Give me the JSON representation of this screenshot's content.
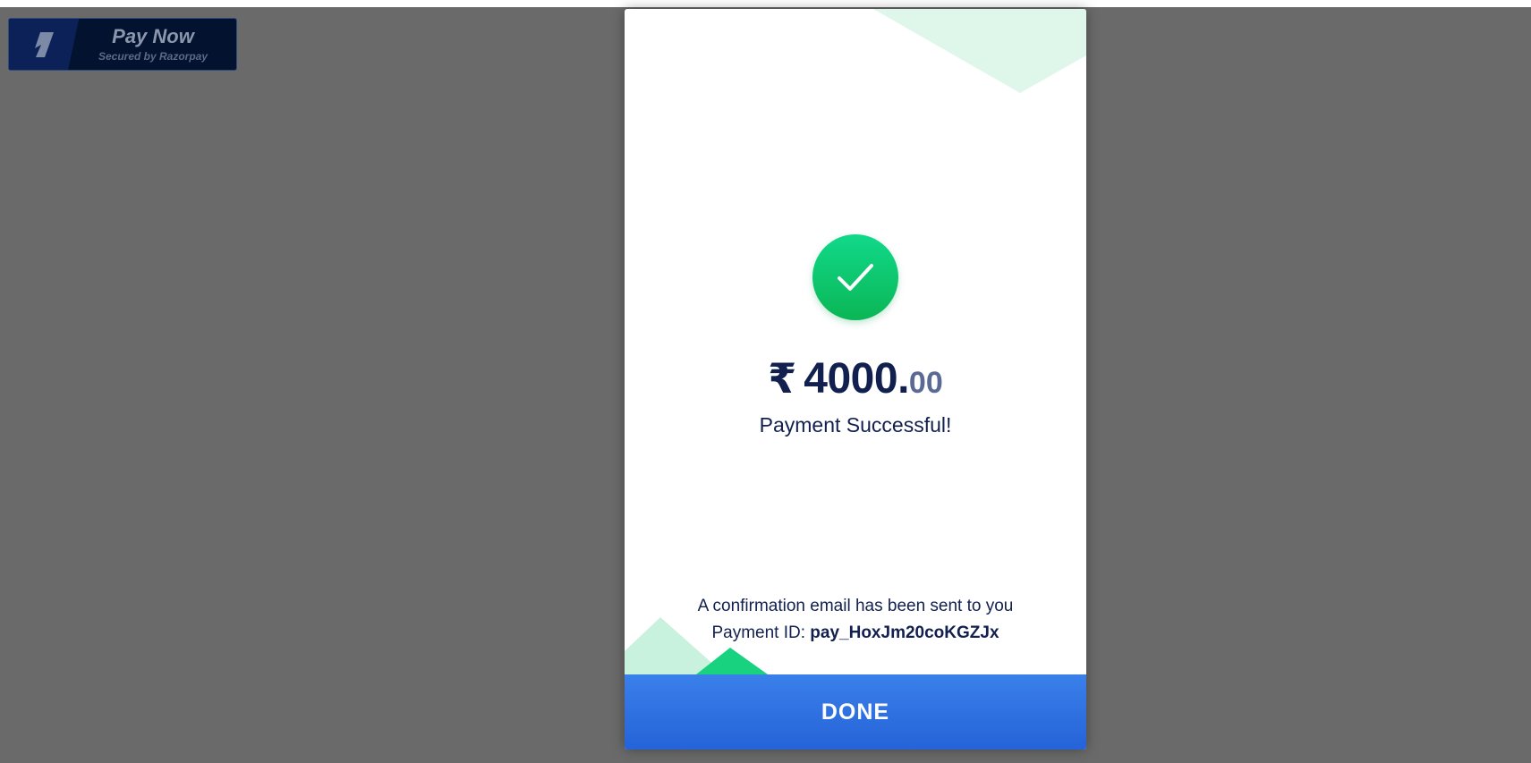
{
  "pay_button": {
    "title": "Pay Now",
    "subtitle": "Secured by Razorpay",
    "icon": "razorpay-logo-icon"
  },
  "success_modal": {
    "status_icon": "checkmark-icon",
    "amount": {
      "currency_symbol": "₹",
      "whole": "4000.",
      "decimal": "00"
    },
    "status_text": "Payment Successful!",
    "confirmation_text": "A confirmation email has been sent to you",
    "payment_id_label": "Payment ID:",
    "payment_id": "pay_HoxJm20coKGZJx",
    "done_label": "DONE"
  },
  "colors": {
    "overlay": "#6a6a6a",
    "success_green": "#0bb655",
    "text_navy": "#12204f",
    "done_blue": "#2f72e2",
    "pay_button_bg": "#03122e"
  }
}
